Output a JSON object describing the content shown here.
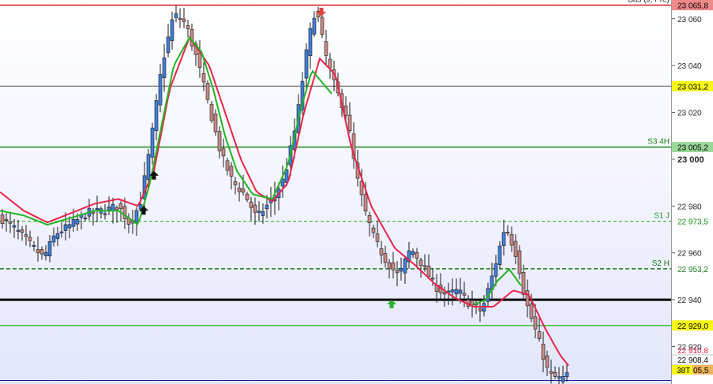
{
  "chart_data": {
    "type": "candlestick",
    "ylim": [
      22904,
      23068
    ],
    "y_ticks": [
      {
        "value": 23060,
        "label": "23 060",
        "bold": false
      },
      {
        "value": 23040,
        "label": "23 040",
        "bold": false
      },
      {
        "value": 23020,
        "label": "23 020",
        "bold": false
      },
      {
        "value": 23000,
        "label": "23 000",
        "bold": true
      },
      {
        "value": 22980,
        "label": "22 980",
        "bold": false
      },
      {
        "value": 22960,
        "label": "22 960",
        "bold": false
      },
      {
        "value": 22940,
        "label": "22 940",
        "bold": false
      },
      {
        "value": 22920,
        "label": "22 920",
        "bold": false
      }
    ],
    "top_partial_tag": "23 070,9",
    "levels": [
      {
        "name": "Bas (J, Pré)",
        "value": 23065.8,
        "tag": "23 065,8",
        "color": "#d91a1a",
        "tag_bg": "#f08a8a",
        "tag_fg": "#000000",
        "dash": "",
        "width": 1.5
      },
      {
        "name": "",
        "value": 23031.2,
        "tag": "23 031,2",
        "color": "#555555",
        "tag_bg": "#f7f716",
        "tag_fg": "#000000",
        "dash": "",
        "width": 1
      },
      {
        "name": "S3 4H",
        "value": 23005.2,
        "tag": "23 005,2",
        "color": "#1b8a1b",
        "tag_bg": "#9ad89a",
        "tag_fg": "#000000",
        "dash": "",
        "width": 1.5
      },
      {
        "name": "S1 J",
        "value": 22973.5,
        "tag": "22 973,5",
        "color": "#2aa02a",
        "tag_bg": "#ffffff",
        "tag_fg": "#1b8a1b",
        "dash": "4,3",
        "width": 1
      },
      {
        "name": "S2 H",
        "value": 22953.2,
        "tag": "22 953,2",
        "color": "#1b7a1b",
        "tag_bg": "#ffffff",
        "tag_fg": "#1b7a1b",
        "dash": "5,3",
        "width": 1.5
      },
      {
        "name": "",
        "value": 22940,
        "tag": "",
        "color": "#000000",
        "tag_bg": "",
        "tag_fg": "",
        "dash": "",
        "width": 3
      },
      {
        "name": "",
        "value": 22929.0,
        "tag": "22 929,0",
        "color": "#3cbf3c",
        "tag_bg": "#f7f716",
        "tag_fg": "#000000",
        "dash": "",
        "width": 1.5
      },
      {
        "name": "",
        "value": 22905.5,
        "tag": "",
        "color": "#1a1aa8",
        "tag_bg": "",
        "tag_fg": "",
        "dash": "",
        "width": 1
      }
    ],
    "last_tags": {
      "red_value": "22 910,8",
      "price_value": "22 908,4",
      "bottom_prefix": "38T",
      "bottom_value": "05,5"
    },
    "red_ma_anchors": [
      [
        0,
        22986
      ],
      [
        30,
        22978
      ],
      [
        60,
        22973
      ],
      [
        90,
        22977
      ],
      [
        120,
        22981
      ],
      [
        150,
        22983
      ],
      [
        175,
        22980
      ],
      [
        195,
        22995
      ],
      [
        215,
        23030
      ],
      [
        240,
        23052
      ],
      [
        265,
        23040
      ],
      [
        285,
        23020
      ],
      [
        305,
        23000
      ],
      [
        325,
        22986
      ],
      [
        345,
        22982
      ],
      [
        365,
        22990
      ],
      [
        385,
        23020
      ],
      [
        405,
        23043
      ],
      [
        425,
        23036
      ],
      [
        445,
        23005
      ],
      [
        470,
        22980
      ],
      [
        500,
        22962
      ],
      [
        525,
        22955
      ],
      [
        550,
        22947
      ],
      [
        575,
        22941
      ],
      [
        600,
        22937
      ],
      [
        625,
        22937
      ],
      [
        650,
        22944
      ],
      [
        670,
        22942
      ],
      [
        690,
        22928
      ],
      [
        710,
        22916
      ],
      [
        722,
        22911
      ]
    ],
    "green_ma_anchors": [
      [
        0,
        22978
      ],
      [
        30,
        22976
      ],
      [
        60,
        22972
      ],
      [
        90,
        22975
      ],
      [
        120,
        22978
      ],
      [
        150,
        22978
      ],
      [
        175,
        22972
      ],
      [
        190,
        22990
      ],
      [
        205,
        23015
      ],
      [
        220,
        23040
      ],
      [
        240,
        23052
      ],
      [
        255,
        23046
      ],
      [
        270,
        23030
      ],
      [
        285,
        23010
      ],
      [
        300,
        22995
      ],
      [
        320,
        22985
      ],
      [
        345,
        22983
      ],
      [
        365,
        22998
      ],
      [
        380,
        23020
      ],
      [
        395,
        23038
      ],
      [
        405,
        23034
      ],
      [
        420,
        23028
      ]
    ],
    "green_ma2_anchors": [
      [
        600,
        22938
      ],
      [
        615,
        22940
      ],
      [
        630,
        22948
      ],
      [
        645,
        22953
      ],
      [
        660,
        22946
      ]
    ],
    "price_anchors": [
      [
        0,
        22975
      ],
      [
        20,
        22970
      ],
      [
        40,
        22963
      ],
      [
        55,
        22958
      ],
      [
        70,
        22968
      ],
      [
        90,
        22972
      ],
      [
        110,
        22977
      ],
      [
        130,
        22978
      ],
      [
        150,
        22980
      ],
      [
        165,
        22972
      ],
      [
        178,
        22982
      ],
      [
        190,
        23005
      ],
      [
        205,
        23040
      ],
      [
        220,
        23062
      ],
      [
        235,
        23058
      ],
      [
        250,
        23042
      ],
      [
        265,
        23022
      ],
      [
        280,
        23002
      ],
      [
        295,
        22990
      ],
      [
        310,
        22985
      ],
      [
        325,
        22975
      ],
      [
        345,
        22983
      ],
      [
        360,
        22992
      ],
      [
        375,
        23015
      ],
      [
        390,
        23050
      ],
      [
        400,
        23065
      ],
      [
        412,
        23045
      ],
      [
        425,
        23030
      ],
      [
        440,
        23018
      ],
      [
        450,
        22995
      ],
      [
        462,
        22978
      ],
      [
        475,
        22965
      ],
      [
        490,
        22956
      ],
      [
        505,
        22950
      ],
      [
        520,
        22962
      ],
      [
        535,
        22955
      ],
      [
        550,
        22946
      ],
      [
        565,
        22942
      ],
      [
        580,
        22944
      ],
      [
        595,
        22938
      ],
      [
        610,
        22935
      ],
      [
        625,
        22952
      ],
      [
        640,
        22972
      ],
      [
        655,
        22958
      ],
      [
        665,
        22940
      ],
      [
        680,
        22925
      ],
      [
        695,
        22908
      ],
      [
        710,
        22906
      ],
      [
        720,
        22908
      ]
    ],
    "markers": [
      {
        "type": "up-arrow",
        "x": 195,
        "value": 22993,
        "color": "#111111"
      },
      {
        "type": "up-arrow",
        "x": 182,
        "value": 22978,
        "color": "#111111"
      },
      {
        "type": "down-arrow",
        "x": 407,
        "value": 23063,
        "color": "#e04040"
      },
      {
        "type": "up-arrow",
        "x": 496,
        "value": 22938,
        "color": "#2fb02f"
      }
    ]
  }
}
